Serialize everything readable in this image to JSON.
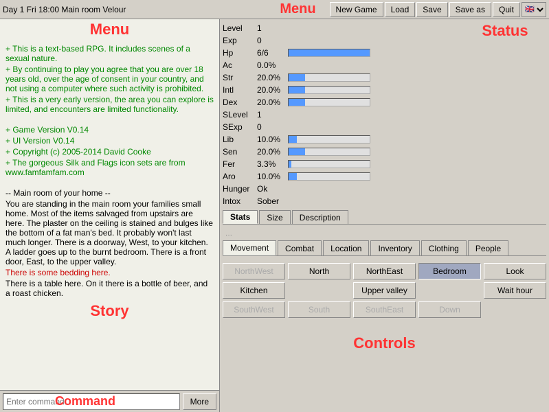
{
  "topbar": {
    "title": "Day 1  Fri 18:00  Main room  Velour",
    "buttons": {
      "new_game": "New Game",
      "load": "Load",
      "save": "Save",
      "save_as": "Save as",
      "quit": "Quit"
    },
    "menu_label": "Menu"
  },
  "story": {
    "label": "Story",
    "lines": [
      {
        "type": "green",
        "text": "+  This is a text-based RPG. It includes scenes of a sexual nature."
      },
      {
        "type": "green",
        "text": "+  By continuing to play you agree that you are over 18 years old, over the age of consent in your country, and not using a computer where such activity is prohibited."
      },
      {
        "type": "green",
        "text": "+  This is a very early version, the area you can explore is limited, and encounters are limited functionality."
      },
      {
        "type": "blank",
        "text": ""
      },
      {
        "type": "green",
        "text": "+  Game Version V0.14"
      },
      {
        "type": "green",
        "text": "+  UI Version V0.14"
      },
      {
        "type": "green",
        "text": "+  Copyright (c) 2005-2014 David Cooke"
      },
      {
        "type": "green",
        "text": "+  The gorgeous Silk and Flags icon sets are from www.famfamfam.com"
      },
      {
        "type": "blank",
        "text": ""
      },
      {
        "type": "normal",
        "text": "-- Main room of your home --"
      },
      {
        "type": "normal",
        "text": " You are standing in the main room your families small home. Most of the items salvaged from upstairs are here. The plaster on the ceiling is stained and bulges like the bottom of a fat man's bed. It probably won't last much longer. There is a doorway, West, to your kitchen. A ladder goes up to the burnt bedroom. There is a front door, East, to the upper valley."
      },
      {
        "type": "red",
        "text": "There is some bedding here."
      },
      {
        "type": "normal",
        "text": "There is a table here. On it there is a bottle of beer, and a roast chicken."
      }
    ]
  },
  "command": {
    "placeholder": "Enter command...",
    "label": "Command",
    "more_label": "More"
  },
  "status": {
    "label": "Status",
    "stats": [
      {
        "name": "Level",
        "value": "1",
        "bar": 0
      },
      {
        "name": "Exp",
        "value": "0",
        "bar": 0
      },
      {
        "name": "Hp",
        "value": "6/6",
        "bar": 100
      },
      {
        "name": "Ac",
        "value": "0.0%",
        "bar": 0
      },
      {
        "name": "Str",
        "value": "20.0%",
        "bar": 20
      },
      {
        "name": "Intl",
        "value": "20.0%",
        "bar": 20
      },
      {
        "name": "Dex",
        "value": "20.0%",
        "bar": 20
      },
      {
        "name": "SLevel",
        "value": "1",
        "bar": 0
      },
      {
        "name": "SExp",
        "value": "0",
        "bar": 0
      },
      {
        "name": "Lib",
        "value": "10.0%",
        "bar": 10
      },
      {
        "name": "Sen",
        "value": "20.0%",
        "bar": 20
      },
      {
        "name": "Fer",
        "value": "3.3%",
        "bar": 3
      },
      {
        "name": "Aro",
        "value": "10.0%",
        "bar": 10
      },
      {
        "name": "Hunger",
        "value": "Ok",
        "bar": 0
      },
      {
        "name": "Intox",
        "value": "Sober",
        "bar": 0
      }
    ],
    "tabs": [
      "Stats",
      "Size",
      "Description"
    ]
  },
  "controls": {
    "label": "Controls",
    "tabs": [
      "Movement",
      "Combat",
      "Location",
      "Inventory",
      "Clothing",
      "People"
    ],
    "active_tab": "Movement",
    "movement": {
      "buttons": [
        {
          "label": "NorthWest",
          "enabled": false,
          "col": 1,
          "row": 1
        },
        {
          "label": "North",
          "enabled": true,
          "col": 2,
          "row": 1
        },
        {
          "label": "NorthEast",
          "enabled": true,
          "col": 3,
          "row": 1
        },
        {
          "label": "Bedroom",
          "enabled": true,
          "col": 4,
          "row": 1,
          "active": true
        },
        {
          "label": "Look",
          "enabled": true,
          "col": 5,
          "row": 1
        },
        {
          "label": "Kitchen",
          "enabled": true,
          "col": 1,
          "row": 2
        },
        {
          "label": "",
          "enabled": false,
          "col": 2,
          "row": 2,
          "spacer": true
        },
        {
          "label": "Upper valley",
          "enabled": true,
          "col": 3,
          "row": 2
        },
        {
          "label": "",
          "enabled": false,
          "col": 4,
          "row": 2,
          "spacer": true
        },
        {
          "label": "Wait hour",
          "enabled": true,
          "col": 5,
          "row": 2
        },
        {
          "label": "SouthWest",
          "enabled": false,
          "col": 1,
          "row": 3
        },
        {
          "label": "South",
          "enabled": false,
          "col": 2,
          "row": 3
        },
        {
          "label": "SouthEast",
          "enabled": false,
          "col": 3,
          "row": 3
        },
        {
          "label": "Down",
          "enabled": false,
          "col": 4,
          "row": 3
        }
      ]
    }
  }
}
